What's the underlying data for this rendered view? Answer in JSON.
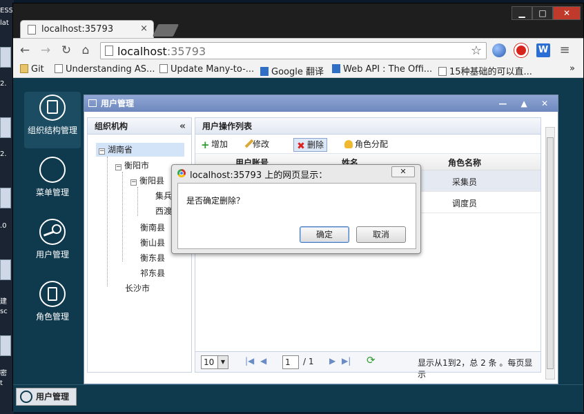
{
  "desktop": {
    "labels": [
      "ESS",
      "lat",
      "2.",
      "2.",
      ".0",
      "建",
      "sc",
      "密",
      "t"
    ]
  },
  "browser": {
    "tab_title": "localhost:35793",
    "tab_close": "×",
    "window_buttons": {
      "minimize": "▁",
      "maximize": "□",
      "close": "✕"
    },
    "url_host": "localhost",
    "url_port": ":35793",
    "nav": {
      "back": "←",
      "forward": "→",
      "reload": "↻",
      "home": "⌂"
    },
    "star": "☆",
    "menu": "≡",
    "bookmarks": [
      {
        "label": "Git",
        "icon": "folder-icon"
      },
      {
        "label": "Understanding AS...",
        "icon": "page-icon"
      },
      {
        "label": "Update Many-to-...",
        "icon": "page-icon"
      },
      {
        "label": "Google 翻译",
        "icon": "translate-icon"
      },
      {
        "label": "Web API : The Offi...",
        "icon": "aspnet-icon"
      },
      {
        "label": "15种基础的可以直...",
        "icon": "page-icon"
      }
    ],
    "bookmarks_more": "»"
  },
  "sidenav": {
    "items": [
      {
        "label": "组织结构管理"
      },
      {
        "label": "菜单管理"
      },
      {
        "label": "用户管理"
      },
      {
        "label": "角色管理"
      }
    ]
  },
  "panel": {
    "title": "用户管理",
    "tools": "— ▲ ✕"
  },
  "org": {
    "title": "组织机构",
    "collapse": "«",
    "tree": {
      "root": "湖南省",
      "city1": "衡阳市",
      "county1": "衡阳县",
      "leaf1": "集兵",
      "leaf2": "西渡",
      "county2": "衡南县",
      "county3": "衡山县",
      "county4": "衡东县",
      "county5": "祁东县",
      "city2": "长沙市"
    }
  },
  "list": {
    "title": "用户操作列表",
    "toolbar": {
      "add": "增加",
      "edit": "修改",
      "delete": "删除",
      "assign_role": "角色分配"
    },
    "columns": {
      "account": "用户账号",
      "name": "姓名",
      "role": "角色名称"
    },
    "rows": [
      {
        "role": "采集员"
      },
      {
        "role": "调度员"
      }
    ],
    "pager": {
      "page_size": "10",
      "page": "1",
      "total_pages": "/ 1",
      "summary": "显示从1到2，总 2 条 。每页显示"
    }
  },
  "taskbar": {
    "item": "用户管理"
  },
  "dialog": {
    "title": "localhost:35793 上的网页显示：",
    "close": "✕",
    "message": "是否确定删除？",
    "ok": "确定",
    "cancel": "取消"
  },
  "colors": {
    "panel_header": "#7a92c6",
    "page_bg": "#0f3a4e",
    "selection": "#d3e3f8"
  }
}
